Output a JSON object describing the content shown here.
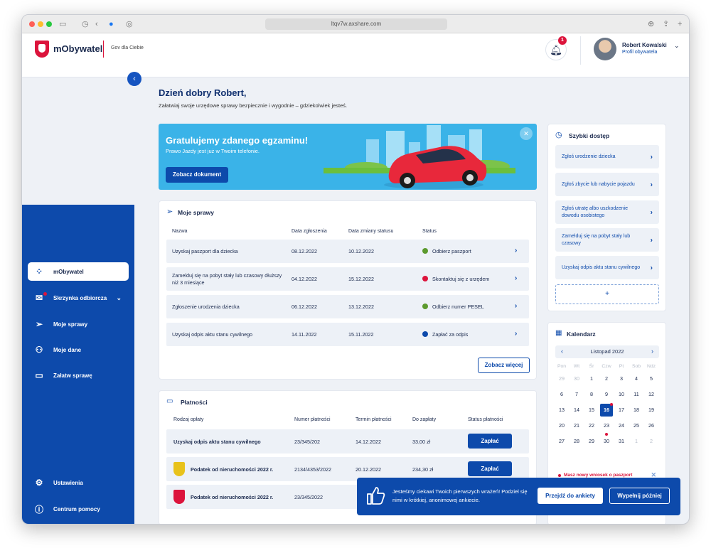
{
  "browser": {
    "url": "ltqv7w.axshare.com"
  },
  "header": {
    "brand": "mObywatel",
    "brand_sub": "Gov dla Ciebie",
    "notifications": "1",
    "user_name": "Robert Kowalski",
    "user_role": "Profil obywatela"
  },
  "sidebar": {
    "items": [
      {
        "label": "mObywatel"
      },
      {
        "label": "Skrzynka odbiorcza"
      },
      {
        "label": "Moje sprawy"
      },
      {
        "label": "Moje dane"
      },
      {
        "label": "Załatw sprawę"
      }
    ],
    "bottom": [
      {
        "label": "Ustawienia"
      },
      {
        "label": "Centrum pomocy"
      }
    ]
  },
  "greeting": {
    "title": "Dzień dobry Robert,",
    "subtitle": "Załatwiaj swoje urzędowe sprawy bezpiecznie i wygodnie – gdziekolwiek jesteś."
  },
  "banner": {
    "title": "Gratulujemy zdanego egzaminu!",
    "subtitle": "Prawo Jazdy jest już w Twoim telefonie.",
    "button": "Zobacz dokument",
    "close": "✕"
  },
  "cases": {
    "title": "Moje sprawy",
    "headers": [
      "Nazwa",
      "Data zgłoszenia",
      "Data zmiany statusu",
      "Status"
    ],
    "rows": [
      {
        "name": "Uzyskaj paszport dla dziecka",
        "submitted": "08.12.2022",
        "changed": "10.12.2022",
        "status": "Odbierz paszport",
        "color": "#5c9a2e"
      },
      {
        "name": "Zamelduj się na pobyt stały lub czasowy dłuższy niż 3 miesiące",
        "submitted": "04.12.2022",
        "changed": "15.12.2022",
        "status": "Skontaktuj się z urzędem",
        "color": "#dc143c"
      },
      {
        "name": "Zgłoszenie urodzenia dziecka",
        "submitted": "06.12.2022",
        "changed": "13.12.2022",
        "status": "Odbierz numer PESEL",
        "color": "#5c9a2e"
      },
      {
        "name": "Uzyskaj odpis aktu stanu cywilnego",
        "submitted": "14.11.2022",
        "changed": "15.11.2022",
        "status": "Zapłać za odpis",
        "color": "#0d4aab"
      }
    ],
    "more_button": "Zobacz więcej"
  },
  "payments": {
    "title": "Płatności",
    "headers": [
      "Rodzaj opłaty",
      "Numer płatności",
      "Termin płatności",
      "Do zapłaty",
      "Status płatności"
    ],
    "rows": [
      {
        "name": "Uzyskaj odpis aktu stanu cywilnego",
        "number": "23/345/202",
        "due": "14.12.2022",
        "amount": "33,00 zł",
        "button": "Zapłać"
      },
      {
        "name": "Podatek od nieruchomości 2022 r.",
        "number": "2134/4353/2022",
        "due": "20.12.2022",
        "amount": "234,30 zł",
        "button": "Zapłać"
      },
      {
        "name": "Podatek od nieruchomości 2022 r.",
        "number": "23/345/2022",
        "due": "",
        "amount": "",
        "button": ""
      }
    ]
  },
  "quick_access": {
    "title": "Szybki dostęp",
    "items": [
      {
        "label": "Zgłoś urodzenie dziecka"
      },
      {
        "label": "Zgłoś zbycie lub nabycie pojazdu"
      },
      {
        "label": "Zgłoś utratę albo uszkodzenie dowodu osobistego"
      },
      {
        "label": "Zamelduj się na pobyt stały lub czasowy"
      },
      {
        "label": "Uzyskaj odpis aktu stanu cywilnego"
      }
    ],
    "add": "+"
  },
  "calendar": {
    "title": "Kalendarz",
    "month": "Listopad 2022",
    "weekdays": [
      "Pon",
      "Wt",
      "Śr",
      "Czw",
      "Pt",
      "Sob",
      "Ndz"
    ],
    "weeks": [
      [
        "29",
        "30",
        "1",
        "2",
        "3",
        "4",
        "5"
      ],
      [
        "6",
        "7",
        "8",
        "9",
        "10",
        "11",
        "12"
      ],
      [
        "13",
        "14",
        "15",
        "16",
        "17",
        "18",
        "19"
      ],
      [
        "20",
        "21",
        "22",
        "23",
        "24",
        "25",
        "26"
      ],
      [
        "27",
        "28",
        "29",
        "30",
        "31",
        "1",
        "2"
      ]
    ],
    "today": "16",
    "event_note": "Masz nowy wniosek o paszport"
  },
  "toast": {
    "text": "Jesteśmy ciekawi Twoich pierwszych wrażeń! Podziel się nimi w krótkiej, anonimowej ankiecie.",
    "primary": "Przejdź do ankiety",
    "secondary": "Wypełnij później"
  }
}
